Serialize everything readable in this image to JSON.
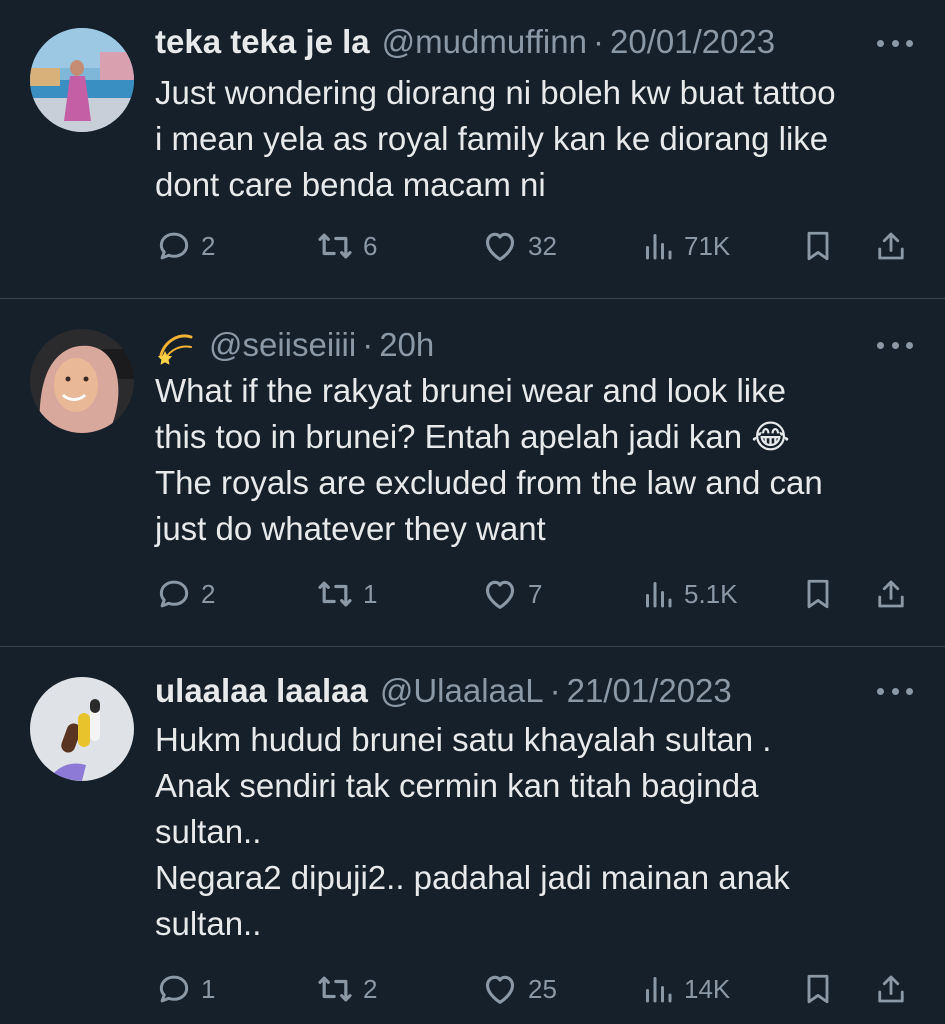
{
  "tweets": [
    {
      "display_name": "teka teka je la",
      "handle": "@mudmuffinn",
      "separator": "·",
      "date": "20/01/2023",
      "lines": [
        "Just wondering diorang ni boleh kw buat tattoo",
        "i mean yela as royal family kan ke diorang like",
        "dont care benda macam ni"
      ],
      "replies": "2",
      "retweets": "6",
      "likes": "32",
      "views": "71K"
    },
    {
      "display_name_emoji": "💫",
      "handle": "@seiiseiiii",
      "separator": "·",
      "date": "20h",
      "lines": [
        "What if the rakyat brunei wear and look like",
        "this too in brunei? Entah apelah jadi kan 😂",
        "The royals are excluded from the law and can",
        "just do whatever they want"
      ],
      "replies": "2",
      "retweets": "1",
      "likes": "7",
      "views": "5.1K"
    },
    {
      "display_name": "ulaalaa laalaa",
      "handle": "@UlaalaaL",
      "separator": "·",
      "date": "21/01/2023",
      "lines": [
        "Hukm hudud brunei satu khayalah sultan .",
        "Anak sendiri tak cermin kan titah baginda",
        "sultan..",
        "Negara2 dipuji2.. padahal jadi mainan anak",
        "sultan.."
      ],
      "replies": "1",
      "retweets": "2",
      "likes": "25",
      "views": "14K"
    }
  ],
  "icons": {
    "reply": "reply-icon",
    "retweet": "retweet-icon",
    "like": "heart-icon",
    "views": "views-icon",
    "bookmark": "bookmark-icon",
    "share": "share-icon",
    "more": "more-icon"
  },
  "colors": {
    "background": "#15202b",
    "text": "#e7e9ea",
    "secondary_text": "#8b98a5",
    "divider": "#38444d"
  }
}
